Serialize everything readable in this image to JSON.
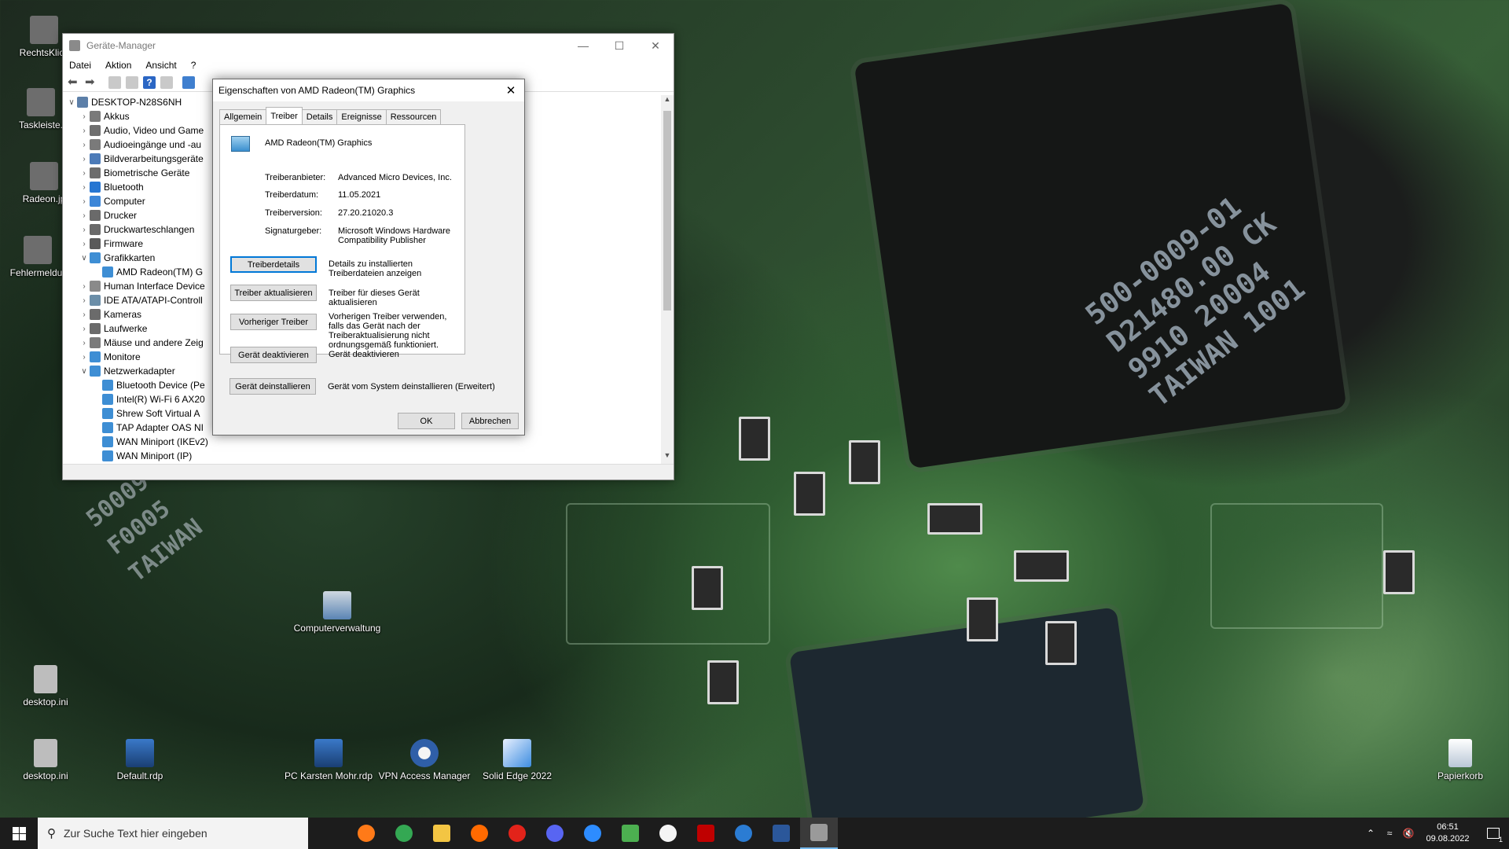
{
  "desktop": {
    "left_icons": [
      {
        "label": "RechtsKlick"
      },
      {
        "label": "Taskleiste."
      },
      {
        "label": "Radeon.jp"
      },
      {
        "label": "Fehlermeldur"
      }
    ],
    "bottom_icons": [
      {
        "label": "Computerverwaltung"
      },
      {
        "label": "desktop.ini"
      },
      {
        "label": "desktop.ini"
      },
      {
        "label": "Default.rdp"
      },
      {
        "label": "PC Karsten Mohr.rdp"
      },
      {
        "label": "VPN Access Manager"
      },
      {
        "label": "Solid Edge 2022"
      },
      {
        "label": "Papierkorb"
      }
    ],
    "wallpaper_text": {
      "chip_lines": "500-0009-01\nD21480.00 CK\n9910 20004\nTAIWAN 1001",
      "chip_left_lines": "50009\nF0005\nTAIWAN"
    }
  },
  "devmgr": {
    "title": "Geräte-Manager",
    "menu": [
      "Datei",
      "Aktion",
      "Ansicht",
      "?"
    ],
    "tree": [
      {
        "label": "DESKTOP-N28S6NH",
        "level": 0,
        "expander": "v"
      },
      {
        "label": "Akkus",
        "level": 1,
        "expander": ">"
      },
      {
        "label": "Audio, Video und Game",
        "level": 1,
        "expander": ">"
      },
      {
        "label": "Audioeingänge und -au",
        "level": 1,
        "expander": ">"
      },
      {
        "label": "Bildverarbeitungsgeräte",
        "level": 1,
        "expander": ">"
      },
      {
        "label": "Biometrische Geräte",
        "level": 1,
        "expander": ">"
      },
      {
        "label": "Bluetooth",
        "level": 1,
        "expander": ">"
      },
      {
        "label": "Computer",
        "level": 1,
        "expander": ">"
      },
      {
        "label": "Drucker",
        "level": 1,
        "expander": ">"
      },
      {
        "label": "Druckwarteschlangen",
        "level": 1,
        "expander": ">"
      },
      {
        "label": "Firmware",
        "level": 1,
        "expander": ">"
      },
      {
        "label": "Grafikkarten",
        "level": 1,
        "expander": "v"
      },
      {
        "label": "AMD Radeon(TM) G",
        "level": 2,
        "expander": ""
      },
      {
        "label": "Human Interface Device",
        "level": 1,
        "expander": ">"
      },
      {
        "label": "IDE ATA/ATAPI-Controll",
        "level": 1,
        "expander": ">"
      },
      {
        "label": "Kameras",
        "level": 1,
        "expander": ">"
      },
      {
        "label": "Laufwerke",
        "level": 1,
        "expander": ">"
      },
      {
        "label": "Mäuse und andere Zeig",
        "level": 1,
        "expander": ">"
      },
      {
        "label": "Monitore",
        "level": 1,
        "expander": ">"
      },
      {
        "label": "Netzwerkadapter",
        "level": 1,
        "expander": "v"
      },
      {
        "label": "Bluetooth Device (Pe",
        "level": 2,
        "expander": ""
      },
      {
        "label": "Intel(R) Wi-Fi 6 AX20",
        "level": 2,
        "expander": ""
      },
      {
        "label": "Shrew Soft Virtual A",
        "level": 2,
        "expander": ""
      },
      {
        "label": "TAP Adapter OAS NI",
        "level": 2,
        "expander": ""
      },
      {
        "label": "WAN Miniport (IKEv2)",
        "level": 2,
        "expander": ""
      },
      {
        "label": "WAN Miniport (IP)",
        "level": 2,
        "expander": ""
      }
    ]
  },
  "dialog": {
    "title": "Eigenschaften von AMD Radeon(TM) Graphics",
    "tabs": [
      "Allgemein",
      "Treiber",
      "Details",
      "Ereignisse",
      "Ressourcen"
    ],
    "device_name": "AMD Radeon(TM) Graphics",
    "fields": [
      {
        "label": "Treiberanbieter:",
        "value": "Advanced Micro Devices, Inc."
      },
      {
        "label": "Treiberdatum:",
        "value": "11.05.2021"
      },
      {
        "label": "Treiberversion:",
        "value": "27.20.21020.3"
      },
      {
        "label": "Signaturgeber:",
        "value": "Microsoft Windows Hardware Compatibility Publisher"
      }
    ],
    "actions": [
      {
        "button": "Treiberdetails",
        "desc": "Details zu installierten Treiberdateien anzeigen"
      },
      {
        "button": "Treiber aktualisieren",
        "desc": "Treiber für dieses Gerät aktualisieren"
      },
      {
        "button": "Vorheriger Treiber",
        "desc": "Vorherigen Treiber verwenden, falls das Gerät nach der Treiberaktualisierung nicht ordnungsgemäß funktioniert."
      },
      {
        "button": "Gerät deaktivieren",
        "desc": "Gerät deaktivieren"
      },
      {
        "button": "Gerät deinstallieren",
        "desc": "Gerät vom System deinstallieren (Erweitert)"
      }
    ],
    "ok": "OK",
    "cancel": "Abbrechen"
  },
  "taskbar": {
    "search_placeholder": "Zur Suche Text hier eingeben",
    "apps": [
      "firefox-icon",
      "chrome-icon",
      "file-explorer-icon",
      "app-orange-icon",
      "app-red-icon",
      "discord-icon",
      "zoom-icon",
      "app-green-icon",
      "linux-icon",
      "filezilla-icon",
      "chat-icon",
      "word-icon",
      "device-manager-icon"
    ],
    "time": "06:51",
    "date": "09.08.2022",
    "notification_count": "1"
  }
}
